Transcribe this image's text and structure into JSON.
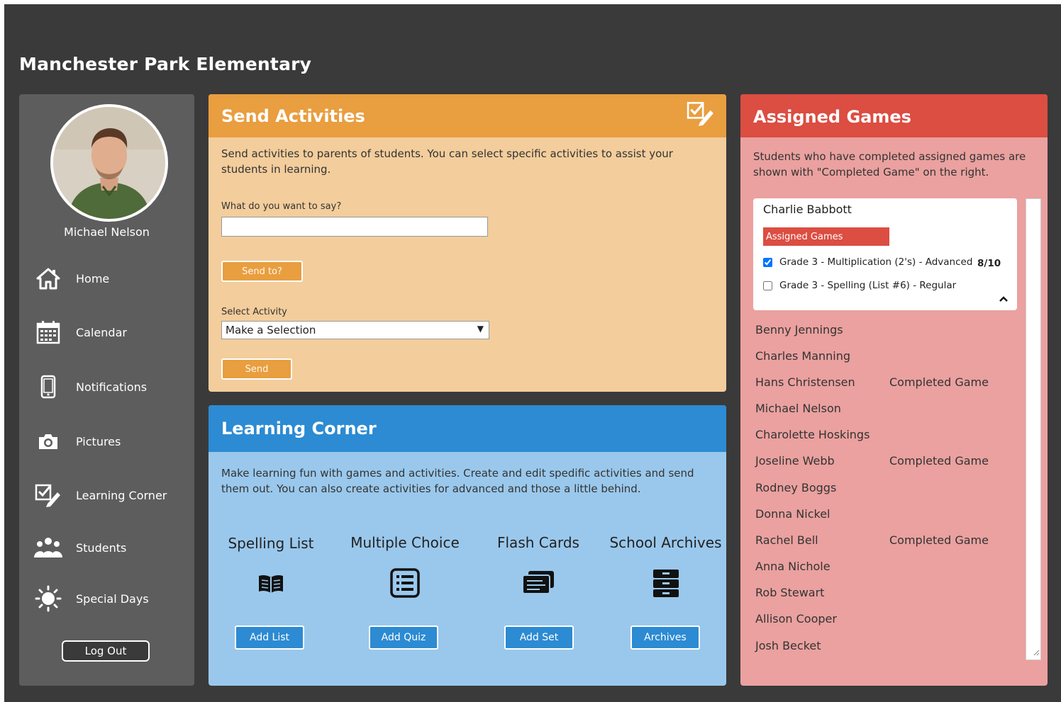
{
  "header": {
    "school_name": "Manchester Park Elementary"
  },
  "sidebar": {
    "user_name": "Michael Nelson",
    "items": [
      {
        "label": "Home",
        "icon": "home-icon"
      },
      {
        "label": "Calendar",
        "icon": "calendar-icon"
      },
      {
        "label": "Notifications",
        "icon": "phone-icon"
      },
      {
        "label": "Pictures",
        "icon": "camera-icon"
      },
      {
        "label": "Learning Corner",
        "icon": "edit-check-icon"
      },
      {
        "label": "Students",
        "icon": "students-icon"
      },
      {
        "label": "Special Days",
        "icon": "sun-icon"
      }
    ],
    "logout_label": "Log Out"
  },
  "send_activities": {
    "title": "Send Activities",
    "description": "Send activities to parents of students.  You can select specific activities to assist your students in learning.",
    "message_label": "What do you want to say?",
    "message_value": "",
    "send_to_label": "Send to?",
    "select_label": "Select Activity",
    "select_value": "Make a Selection",
    "send_label": "Send",
    "accent_color": "#e99e3f"
  },
  "learning_corner": {
    "title": "Learning Corner",
    "description": "Make learning fun with games and activities.  Create and edit spedific activities and send them out.  You can also create activities for advanced and those a little behind.",
    "tools": [
      {
        "title": "Spelling List",
        "icon": "book-icon",
        "button": "Add List"
      },
      {
        "title": "Multiple Choice",
        "icon": "list-icon",
        "button": "Add Quiz"
      },
      {
        "title": "Flash Cards",
        "icon": "cards-icon",
        "button": "Add Set"
      },
      {
        "title": "School Archives",
        "icon": "archive-icon",
        "button": "Archives"
      }
    ],
    "accent_color": "#2c8bd2"
  },
  "assigned_games": {
    "title": "Assigned Games",
    "description": "Students who have completed assigned games are shown with \"Completed Game\" on the right.",
    "expanded_student": {
      "name": "Charlie Babbott",
      "badge": "Assigned Games",
      "games": [
        {
          "label": "Grade 3 - Multiplication (2's) - Advanced",
          "checked": true,
          "score": "8/10"
        },
        {
          "label": "Grade 3 - Spelling (List #6) - Regular",
          "checked": false,
          "score": ""
        }
      ]
    },
    "students": [
      {
        "name": "Benny Jennings",
        "status": ""
      },
      {
        "name": "Charles Manning",
        "status": ""
      },
      {
        "name": "Hans Christensen",
        "status": "Completed Game"
      },
      {
        "name": "Michael Nelson",
        "status": ""
      },
      {
        "name": "Charolette Hoskings",
        "status": ""
      },
      {
        "name": "Joseline Webb",
        "status": "Completed Game"
      },
      {
        "name": "Rodney Boggs",
        "status": ""
      },
      {
        "name": "Donna Nickel",
        "status": ""
      },
      {
        "name": "Rachel Bell",
        "status": "Completed Game"
      },
      {
        "name": "Anna Nichole",
        "status": ""
      },
      {
        "name": "Rob Stewart",
        "status": ""
      },
      {
        "name": "Allison Cooper",
        "status": ""
      },
      {
        "name": "Josh Becket",
        "status": ""
      }
    ],
    "accent_color": "#dc4d42"
  }
}
